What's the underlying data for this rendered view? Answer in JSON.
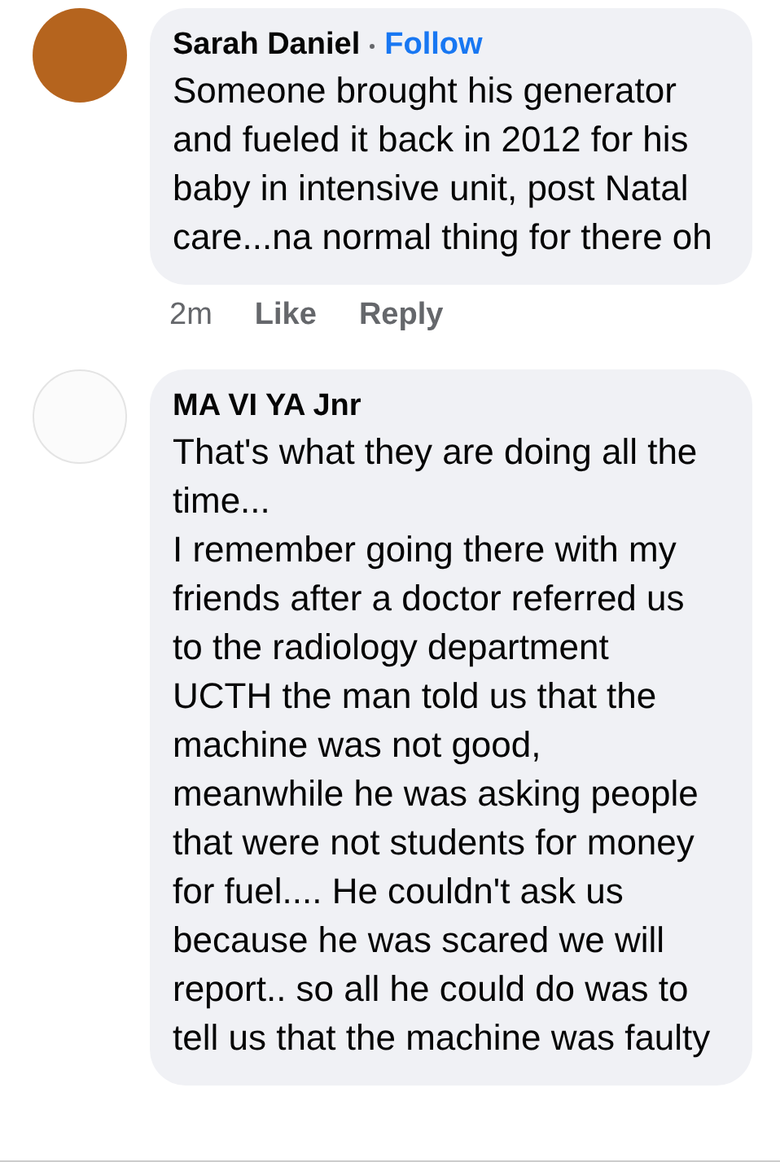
{
  "comments": [
    {
      "author": "Sarah Daniel",
      "follow": "Follow",
      "text": "Someone brought his generator and fueled it back in 2012 for his baby in intensive unit, post Natal care...na normal thing for there oh",
      "actions": {
        "time": "2m",
        "like": "Like",
        "reply": "Reply"
      }
    },
    {
      "author": "MA VI YA Jnr",
      "text": "That's what they are doing all the time...\nI remember going there with my friends after a doctor referred us to the radiology department UCTH the man told us that the machine was not good, meanwhile he was asking people that were not students for money for fuel.... He couldn't ask us because he was scared we will report.. so all he could do was to tell us that the machine was faulty"
    }
  ]
}
